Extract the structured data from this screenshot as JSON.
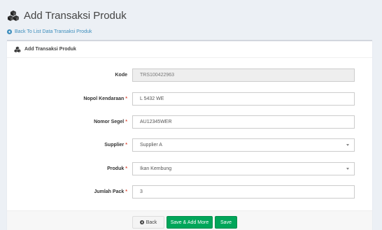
{
  "header": {
    "title": "Add Transaksi Produk",
    "back_link": "Back To List Data Transaksi Produk",
    "icon": "cubes-icon"
  },
  "box": {
    "title": "Add Transaksi Produk",
    "icon": "cubes-icon"
  },
  "form": {
    "kode": {
      "label": "Kode",
      "value": "TRS100422963",
      "required": false,
      "disabled": true
    },
    "nopol": {
      "label": "Nopol Kendaraan",
      "value": "L 5432 WE",
      "required": true
    },
    "segel": {
      "label": "Nomor Segel",
      "value": "AU12345WER",
      "required": true
    },
    "supplier": {
      "label": "Supplier",
      "value": "Supplier A",
      "required": true
    },
    "produk": {
      "label": "Produk",
      "value": "Ikan Kembung",
      "required": true
    },
    "jumlah": {
      "label": "Jumlah Pack",
      "value": "3",
      "required": true
    },
    "required_mark": "*"
  },
  "footer": {
    "back_label": "Back",
    "save_add_label": "Save & Add More",
    "save_label": "Save"
  },
  "colors": {
    "accent": "#3c8dbc",
    "success": "#00a65a",
    "required": "#dd4b39"
  }
}
